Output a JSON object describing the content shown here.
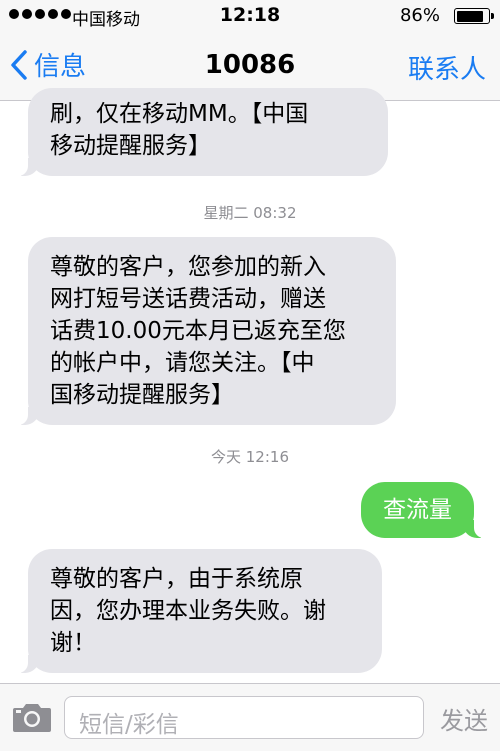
{
  "status_bar": {
    "carrier": "中国移动",
    "time": "12:18",
    "battery_percent": "86%",
    "battery_level": 0.86,
    "signal_bars": 5
  },
  "nav": {
    "back_label": "信息",
    "title": "10086",
    "contact_label": "联系人"
  },
  "messages": [
    {
      "direction": "in",
      "text": "刷，仅在移动MM。【中国\n移动提醒服务】"
    },
    {
      "timestamp": "星期二 08:32"
    },
    {
      "direction": "in",
      "text": "尊敬的客户，您参加的新入\n网打短号送话费活动，赠送\n话费10.00元本月已返充至您\n的帐户中，请您关注。【中\n国移动提醒服务】"
    },
    {
      "timestamp": "今天 12:16"
    },
    {
      "direction": "out",
      "text": "查流量"
    },
    {
      "direction": "in",
      "text": "尊敬的客户，由于系统原\n因，您办理本业务失败。谢\n谢！"
    }
  ],
  "input": {
    "placeholder": "短信/彩信",
    "send_label": "发送"
  },
  "colors": {
    "accent": "#1a7cf2",
    "incoming_bubble": "#e5e5ea",
    "outgoing_bubble": "#5bd255",
    "timestamp": "#8e8e93"
  },
  "icons": [
    "signal-dots-icon",
    "battery-icon",
    "back-chevron-icon",
    "camera-icon"
  ]
}
